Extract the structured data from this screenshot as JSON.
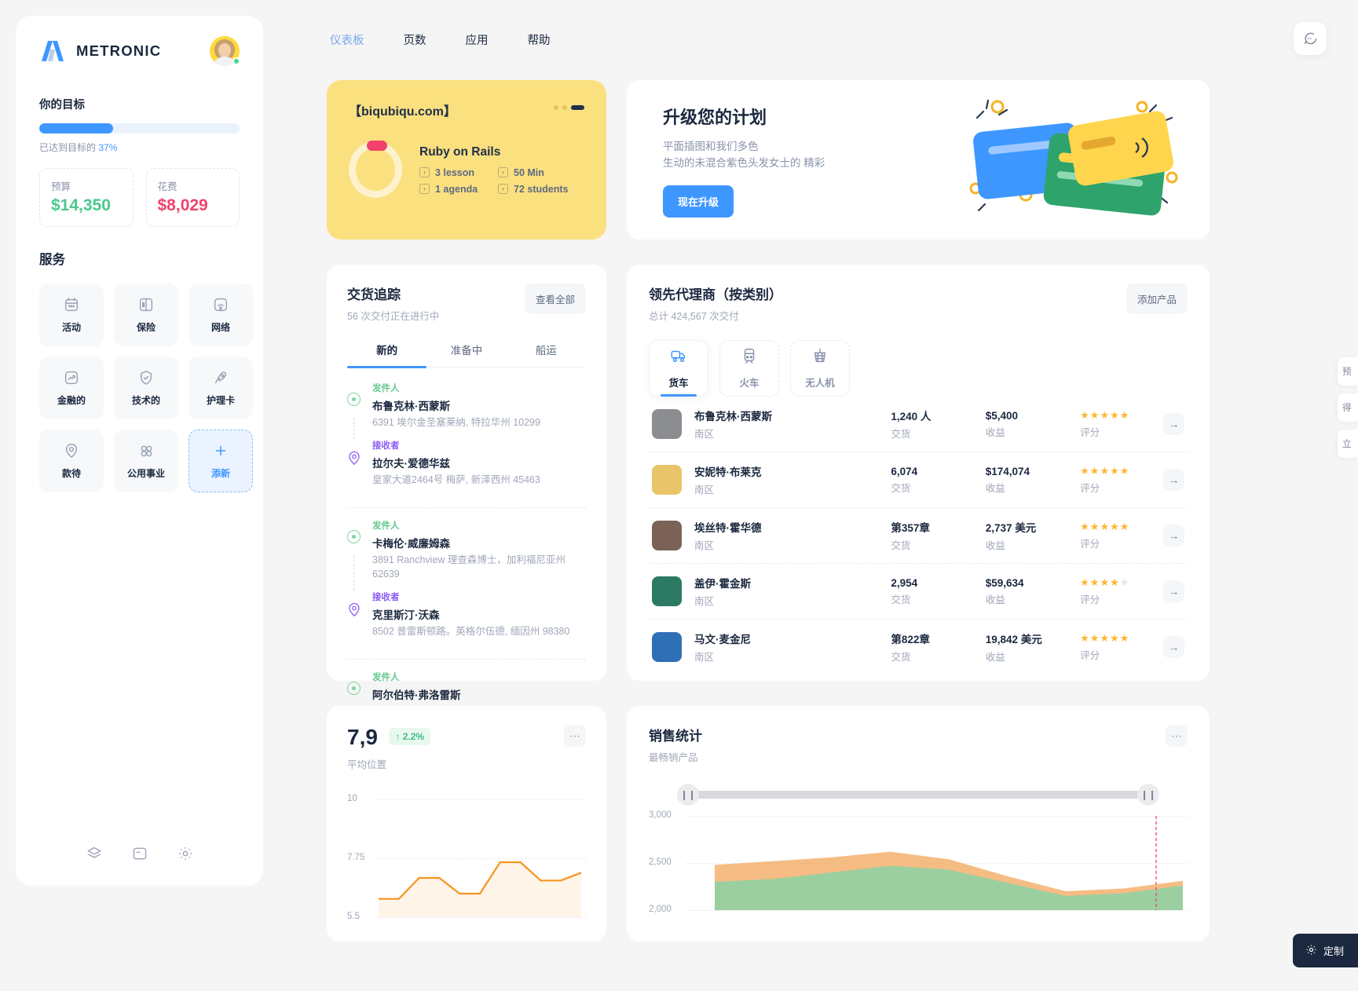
{
  "brand": {
    "name": "METRONIC"
  },
  "topnav": {
    "items": [
      {
        "label": "仪表板",
        "active": true
      },
      {
        "label": "页数",
        "active": false
      },
      {
        "label": "应用",
        "active": false
      },
      {
        "label": "帮助",
        "active": false
      }
    ]
  },
  "sidebar": {
    "goal_title": "你的目标",
    "progress_percent": 37,
    "progress_label_prefix": "已达到目标的",
    "progress_label_value": "37%",
    "stats": [
      {
        "label": "预算",
        "value": "$14,350",
        "color": "#48c98f"
      },
      {
        "label": "花费",
        "value": "$8,029",
        "color": "#f1416c"
      }
    ],
    "services_title": "服务",
    "services": [
      {
        "label": "活动",
        "icon": "calendar-icon"
      },
      {
        "label": "保险",
        "icon": "book-icon"
      },
      {
        "label": "网络",
        "icon": "wifi-icon"
      },
      {
        "label": "金融的",
        "icon": "chart-up-icon"
      },
      {
        "label": "技术的",
        "icon": "shield-check-icon"
      },
      {
        "label": "护理卡",
        "icon": "rocket-icon"
      },
      {
        "label": "款待",
        "icon": "location-pin-icon"
      },
      {
        "label": "公用事业",
        "icon": "grid-dots-icon"
      },
      {
        "label": "添新",
        "icon": "plus-icon",
        "add": true
      }
    ],
    "footer_icons": [
      "layers-icon",
      "note-icon",
      "gear-icon"
    ]
  },
  "course_card": {
    "domain": "【biqubiqu.com】",
    "title": "Ruby on Rails",
    "meta": [
      "3 lesson",
      "50 Min",
      "1 agenda",
      "72 students"
    ]
  },
  "upgrade_card": {
    "title": "升级您的计划",
    "sub_line1": "平面插图和我们多色",
    "sub_line2": "生动的未混合紫色头发女士的 精彩",
    "button": "现在升级"
  },
  "delivery_card": {
    "title": "交货追踪",
    "subtitle": "56 次交付正在进行中",
    "view_all": "查看全部",
    "tabs": [
      {
        "label": "新的",
        "active": true
      },
      {
        "label": "准备中",
        "active": false
      },
      {
        "label": "船运",
        "active": false
      }
    ],
    "role_sender": "发件人",
    "role_receiver": "接收者",
    "groups": [
      {
        "sender_name": "布鲁克林·西蒙斯",
        "sender_addr": "6391 埃尔金圣塞莱纳, 特拉华州 10299",
        "receiver_name": "拉尔夫·爱德华兹",
        "receiver_addr": "皇家大道2464号 梅萨, 新泽西州 45463"
      },
      {
        "sender_name": "卡梅伦·威廉姆森",
        "sender_addr": "3891 Ranchview 理查森博士，加利福尼亚州 62639",
        "receiver_name": "克里斯汀·沃森",
        "receiver_addr": "8502 普雷斯顿路。英格尔伍德, 缅因州 98380"
      },
      {
        "sender_name": "阿尔伯特·弗洛雷斯",
        "sender_addr": "",
        "receiver_name": "",
        "receiver_addr": ""
      }
    ]
  },
  "agents_card": {
    "title": "领先代理商（按类别）",
    "subtitle": "总计 424,567 次交付",
    "add_product": "添加产品",
    "modes": [
      {
        "label": "货车",
        "icon": "truck-icon",
        "active": true
      },
      {
        "label": "火车",
        "icon": "train-icon",
        "active": false
      },
      {
        "label": "无人机",
        "icon": "crane-icon",
        "active": false
      }
    ],
    "caption_delivery": "交货",
    "caption_revenue": "收益",
    "caption_rating": "评分",
    "rows": [
      {
        "name": "布鲁克林·西蒙斯",
        "region": "南区",
        "delivery": "1,240 人",
        "revenue": "$5,400",
        "stars": 5,
        "avatar": "#8b8d90"
      },
      {
        "name": "安妮特·布莱克",
        "region": "南区",
        "delivery": "6,074",
        "revenue": "$174,074",
        "stars": 5,
        "avatar": "#e9c56a"
      },
      {
        "name": "埃丝特·霍华德",
        "region": "南区",
        "delivery": "第357章",
        "revenue": "2,737 美元",
        "stars": 5,
        "avatar": "#7b6257"
      },
      {
        "name": "盖伊·霍金斯",
        "region": "南区",
        "delivery": "2,954",
        "revenue": "$59,634",
        "stars": 4,
        "avatar": "#2c7a63"
      },
      {
        "name": "马文·麦金尼",
        "region": "南区",
        "delivery": "第822章",
        "revenue": "19,842 美元",
        "stars": 5,
        "avatar": "#2f6fb5"
      }
    ]
  },
  "position_card": {
    "value": "7,9",
    "change": "↑ 2.2%",
    "caption": "平均位置",
    "chart_data": {
      "type": "line",
      "title": "平均位置",
      "ylabel": "",
      "xlabel": "",
      "yticks": [
        10,
        7.75,
        5.5
      ],
      "ylim": [
        5.5,
        10
      ],
      "series": [
        {
          "name": "position",
          "values": [
            6.2,
            6.2,
            7.0,
            7.0,
            6.4,
            6.4,
            7.6,
            7.6,
            6.9,
            6.9,
            7.2
          ]
        }
      ],
      "grid": true,
      "legend": "none",
      "color": "#f6941e"
    }
  },
  "sales_card": {
    "title": "销售统计",
    "subtitle": "最畅销产品",
    "chart_data": {
      "type": "area",
      "title": "销售统计",
      "ylabel": "",
      "xlabel": "",
      "yticks": [
        3000,
        2500,
        2000
      ],
      "ylim": [
        2000,
        3000
      ],
      "series": [
        {
          "name": "series-a",
          "color": "#f2a65a",
          "values": [
            2480,
            2520,
            2560,
            2620,
            2540,
            2360,
            2200,
            2230,
            2310
          ]
        },
        {
          "name": "series-b",
          "color": "#7dd6a8",
          "values": [
            2300,
            2330,
            2400,
            2470,
            2430,
            2290,
            2150,
            2180,
            2260
          ]
        }
      ],
      "grid": true,
      "legend": "none"
    }
  },
  "rail": {
    "items": [
      "预",
      "得",
      "立"
    ]
  },
  "customize_fab": {
    "label": "定制",
    "icon": "gear-icon"
  }
}
